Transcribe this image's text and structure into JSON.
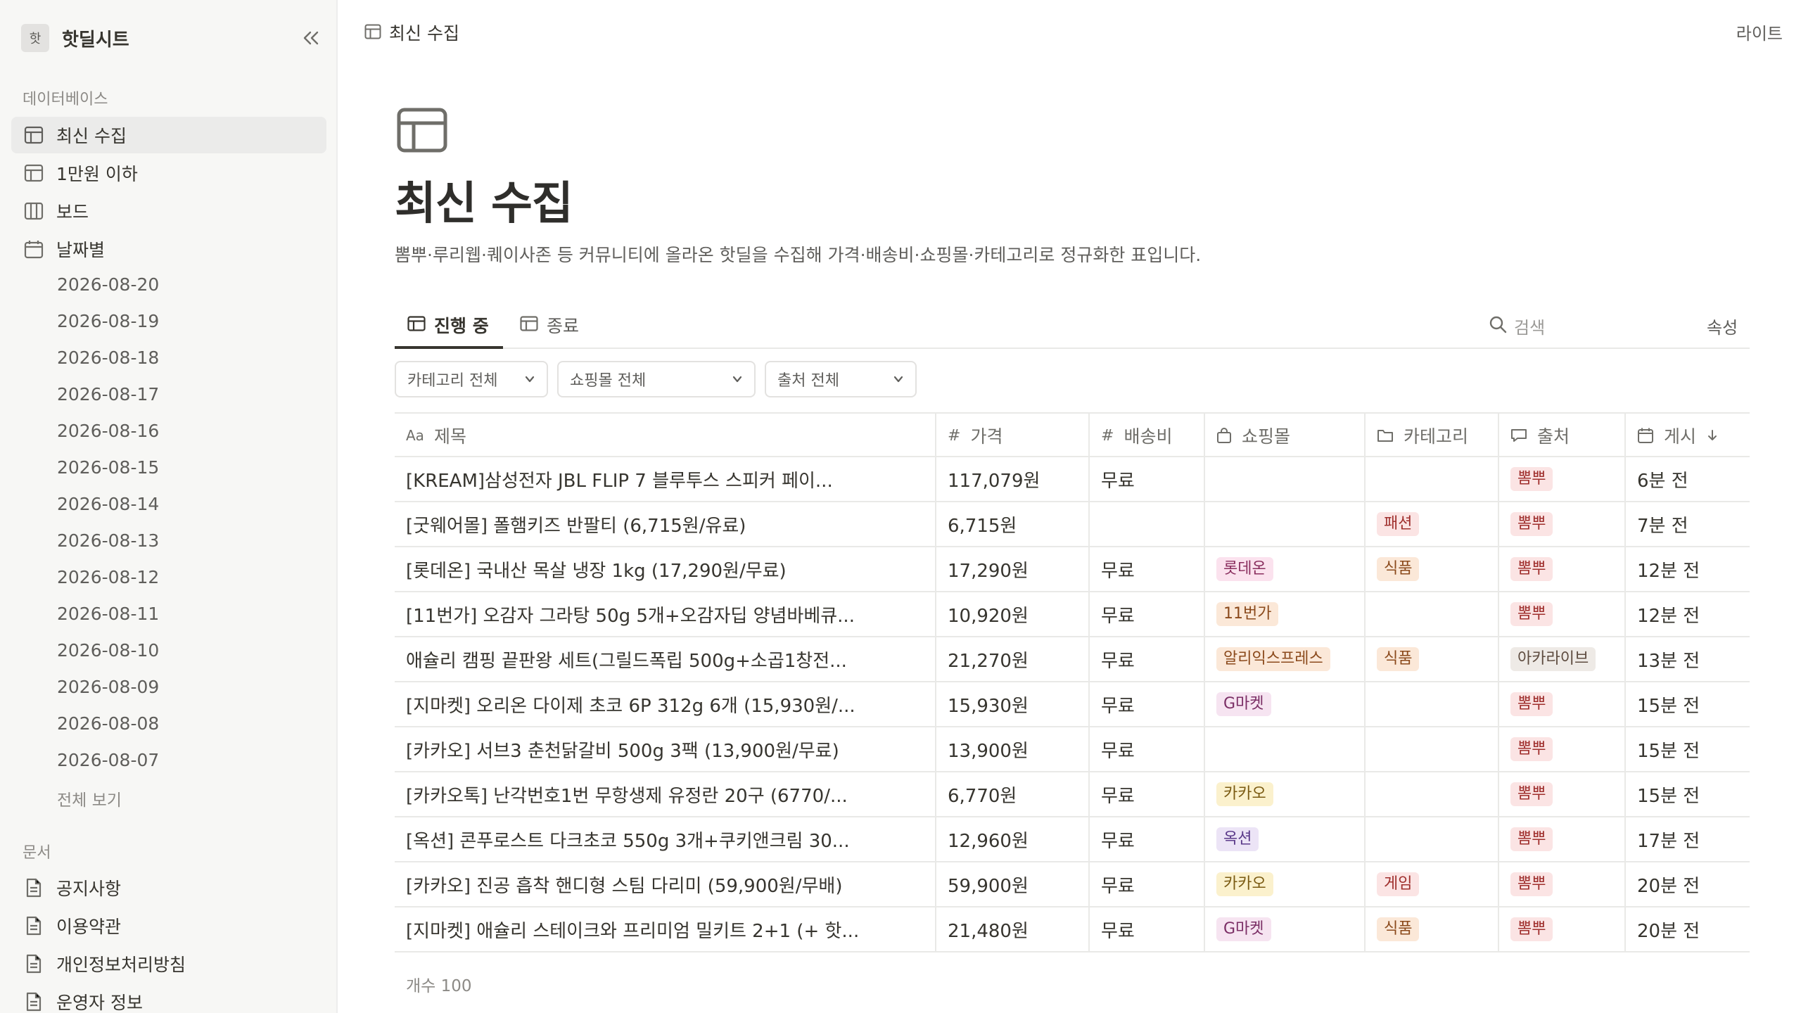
{
  "sidebar": {
    "workspace_badge": "핫",
    "workspace_name": "핫딜시트",
    "section_db": "데이터베이스",
    "db_items": [
      {
        "label": "최신 수집",
        "icon": "table-icon",
        "active": true
      },
      {
        "label": "1만원 이하",
        "icon": "table-icon",
        "active": false
      },
      {
        "label": "보드",
        "icon": "board-icon",
        "active": false
      },
      {
        "label": "날짜별",
        "icon": "calendar-icon",
        "active": false
      }
    ],
    "dates": [
      "2026-08-20",
      "2026-08-19",
      "2026-08-18",
      "2026-08-17",
      "2026-08-16",
      "2026-08-15",
      "2026-08-14",
      "2026-08-13",
      "2026-08-12",
      "2026-08-11",
      "2026-08-10",
      "2026-08-09",
      "2026-08-08",
      "2026-08-07"
    ],
    "see_all": "전체 보기",
    "section_docs": "문서",
    "doc_items": [
      "공지사항",
      "이용약관",
      "개인정보처리방침",
      "운영자 정보"
    ]
  },
  "topbar": {
    "breadcrumb": "최신 수집",
    "theme_button": "라이트"
  },
  "page": {
    "title": "최신 수집",
    "description": "뽐뿌·루리웹·퀘이사존 등 커뮤니티에 올라온 핫딜을 수집해 가격·배송비·쇼핑몰·카테고리로 정규화한 표입니다."
  },
  "tabs": [
    {
      "label": "진행 중",
      "active": true
    },
    {
      "label": "종료",
      "active": false
    }
  ],
  "search_placeholder": "검색",
  "properties_label": "속성",
  "filters": [
    "카테고리 전체",
    "쇼핑몰 전체",
    "출처 전체"
  ],
  "table": {
    "headers": [
      {
        "prefix": "Aa",
        "label": "제목"
      },
      {
        "prefix": "#",
        "label": "가격"
      },
      {
        "prefix": "#",
        "label": "배송비"
      },
      {
        "prefix": "bag-icon",
        "label": "쇼핑몰"
      },
      {
        "prefix": "folder-icon",
        "label": "카테고리"
      },
      {
        "prefix": "comment-icon",
        "label": "출처"
      },
      {
        "prefix": "calendar-icon",
        "label": "게시"
      }
    ],
    "rows": [
      {
        "title": "[KREAM]삼성전자 JBL FLIP 7 블루투스 스피커 페이...",
        "price": "117,079원",
        "shipping": "무료",
        "mall": "",
        "category": "",
        "source": "뽐뿌",
        "posted": "6분 전"
      },
      {
        "title": "[굿웨어몰] 폴햄키즈 반팔티 (6,715원/유료)",
        "price": "6,715원",
        "shipping": "",
        "mall": "",
        "category": "패션",
        "source": "뽐뿌",
        "posted": "7분 전"
      },
      {
        "title": "[롯데온] 국내산 목살 냉장 1kg (17,290원/무료)",
        "price": "17,290원",
        "shipping": "무료",
        "mall": "롯데온",
        "category": "식품",
        "source": "뽐뿌",
        "posted": "12분 전"
      },
      {
        "title": "[11번가] 오감자 그라탕 50g 5개+오감자딥 양념바베큐...",
        "price": "10,920원",
        "shipping": "무료",
        "mall": "11번가",
        "category": "",
        "source": "뽐뿌",
        "posted": "12분 전"
      },
      {
        "title": "애슐리 캠핑 끝판왕 세트(그릴드폭립 500g+소곱1창전...",
        "price": "21,270원",
        "shipping": "무료",
        "mall": "알리익스프레스",
        "category": "식품",
        "source": "아카라이브",
        "posted": "13분 전"
      },
      {
        "title": "[지마켓] 오리온 다이제 초코 6P 312g 6개 (15,930원/...",
        "price": "15,930원",
        "shipping": "무료",
        "mall": "G마켓",
        "category": "",
        "source": "뽐뿌",
        "posted": "15분 전"
      },
      {
        "title": "[카카오] 서브3 춘천닭갈비 500g 3팩 (13,900원/무료)",
        "price": "13,900원",
        "shipping": "무료",
        "mall": "",
        "category": "",
        "source": "뽐뿌",
        "posted": "15분 전"
      },
      {
        "title": "[카카오톡] 난각번호1번 무항생제 유정란 20구 (6770/...",
        "price": "6,770원",
        "shipping": "무료",
        "mall": "카카오",
        "category": "",
        "source": "뽐뿌",
        "posted": "15분 전"
      },
      {
        "title": "[옥션] 콘푸로스트 다크초코 550g 3개+쿠키앤크림 30...",
        "price": "12,960원",
        "shipping": "무료",
        "mall": "옥션",
        "category": "",
        "source": "뽐뿌",
        "posted": "17분 전"
      },
      {
        "title": "[카카오] 진공 흡착 핸디형 스팀 다리미 (59,900원/무배)",
        "price": "59,900원",
        "shipping": "무료",
        "mall": "카카오",
        "category": "게임",
        "source": "뽐뿌",
        "posted": "20분 전"
      },
      {
        "title": "[지마켓] 애슐리 스테이크와 프리미엄 밀키트 2+1 (+ 핫...",
        "price": "21,480원",
        "shipping": "무료",
        "mall": "G마켓",
        "category": "식품",
        "source": "뽐뿌",
        "posted": "20분 전"
      }
    ],
    "footer": "개수 100"
  },
  "tag_colors": {
    "뽐뿌": {
      "bg": "#fbe4e4",
      "fg": "#9f2f2d"
    },
    "아카라이브": {
      "bg": "#eeeae6",
      "fg": "#5d4b3f"
    },
    "롯데온": {
      "bg": "#fbe2ee",
      "fg": "#8a2e5e"
    },
    "11번가": {
      "bg": "#fbe8d8",
      "fg": "#8b4a1c"
    },
    "알리익스프레스": {
      "bg": "#fbe8d8",
      "fg": "#8b4a1c"
    },
    "G마켓": {
      "bg": "#f6e4f1",
      "fg": "#7b2f66"
    },
    "카카오": {
      "bg": "#fbf1cd",
      "fg": "#7a5a12"
    },
    "옥션": {
      "bg": "#ece4f6",
      "fg": "#5b3a8a"
    },
    "식품": {
      "bg": "#fbe8d8",
      "fg": "#8b4a1c"
    },
    "패션": {
      "bg": "#fbe4e4",
      "fg": "#9f2f2d"
    },
    "게임": {
      "bg": "#fbe4e4",
      "fg": "#9f2f2d"
    }
  }
}
